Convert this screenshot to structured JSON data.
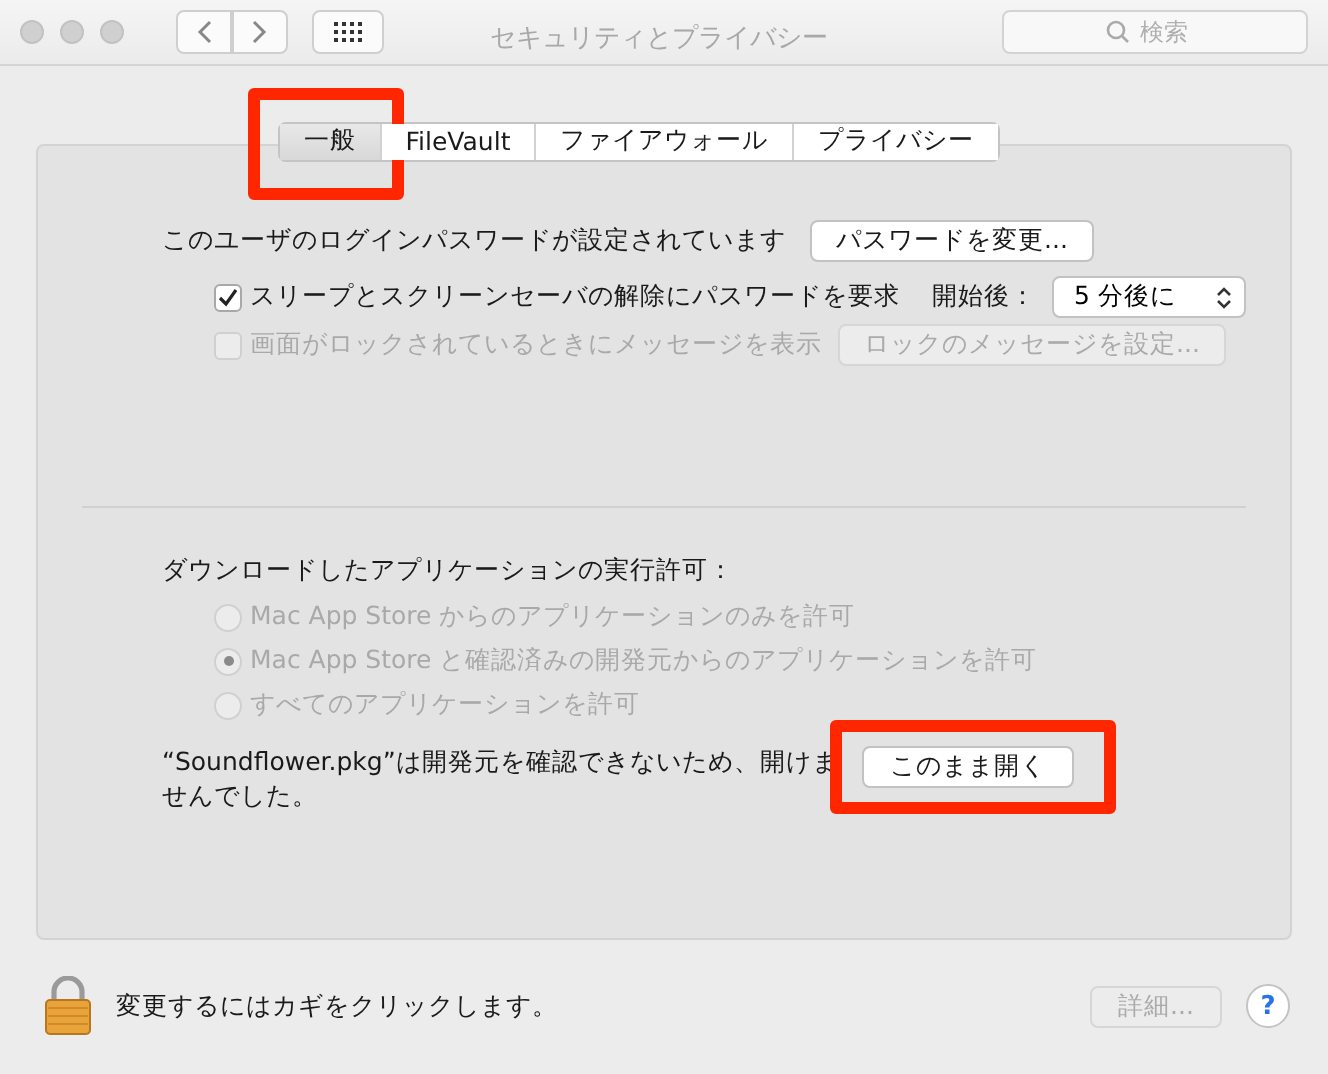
{
  "window": {
    "title": "セキュリティとプライバシー"
  },
  "search": {
    "placeholder": "検索"
  },
  "tabs": [
    {
      "label": "一般",
      "selected": true,
      "annotated": true
    },
    {
      "label": "FileVault",
      "selected": false,
      "annotated": false
    },
    {
      "label": "ファイアウォール",
      "selected": false,
      "annotated": false
    },
    {
      "label": "プライバシー",
      "selected": false,
      "annotated": false
    }
  ],
  "password": {
    "text": "このユーザのログインパスワードが設定されています",
    "button": "パスワードを変更..."
  },
  "options": [
    {
      "kind": "select",
      "label": "スリープとスクリーンセーバの解除にパスワードを要求",
      "checked": true,
      "disabled": false,
      "select_label": "開始後：",
      "select_value": "5 分後に"
    },
    {
      "kind": "button",
      "label": "画面がロックされているときにメッセージを表示",
      "checked": false,
      "disabled": true,
      "button": "ロックのメッセージを設定..."
    }
  ],
  "downloads": {
    "heading": "ダウンロードしたアプリケーションの実行許可：",
    "options": [
      {
        "label": "Mac App Store からのアプリケーションのみを許可",
        "selected": false,
        "disabled": true
      },
      {
        "label": "Mac App Store と確認済みの開発元からのアプリケーションを許可",
        "selected": true,
        "disabled": true
      },
      {
        "label": "すべてのアプリケーションを許可",
        "selected": false,
        "disabled": true
      }
    ],
    "message": "“Soundflower.pkg”は開発元を確認できないため、開けませんでした。",
    "open_button": {
      "label": "このまま開く",
      "annotated": true
    }
  },
  "footer": {
    "lock_text": "変更するにはカギをクリックします。",
    "advanced_button": {
      "label": "詳細...",
      "disabled": true
    },
    "help": "?"
  }
}
